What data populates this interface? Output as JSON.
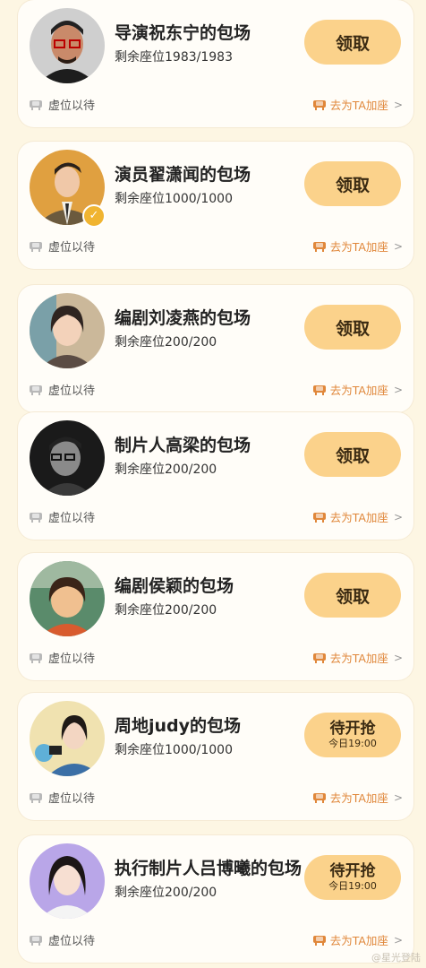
{
  "cards": [
    {
      "title": "导演祝东宁的包场",
      "seats": "剩余座位1983/1983",
      "button": "领取",
      "button_sub": null,
      "avatar": "man-glasses",
      "verified": false,
      "wait_label": "虚位以待",
      "join_label": "去为TA加座"
    },
    {
      "title": "演员翟潇闻的包场",
      "seats": "剩余座位1000/1000",
      "button": "领取",
      "button_sub": null,
      "avatar": "man-suit",
      "verified": true,
      "wait_label": "虚位以待",
      "join_label": "去为TA加座"
    },
    {
      "title": "编剧刘凌燕的包场",
      "seats": "剩余座位200/200",
      "button": "领取",
      "button_sub": null,
      "avatar": "woman-cartoon",
      "verified": false,
      "wait_label": "虚位以待",
      "join_label": "去为TA加座"
    },
    {
      "title": "制片人高梁的包场",
      "seats": "剩余座位200/200",
      "button": "领取",
      "button_sub": null,
      "avatar": "man-bw",
      "verified": false,
      "wait_label": "虚位以待",
      "join_label": "去为TA加座"
    },
    {
      "title": "编剧侯颖的包场",
      "seats": "剩余座位200/200",
      "button": "领取",
      "button_sub": null,
      "avatar": "girl-cartoon",
      "verified": false,
      "wait_label": "虚位以待",
      "join_label": "去为TA加座"
    },
    {
      "title": "周地judy的包场",
      "seats": "剩余座位1000/1000",
      "button": "待开抢",
      "button_sub": "今日19:00",
      "avatar": "woman-camera",
      "verified": false,
      "wait_label": "虚位以待",
      "join_label": "去为TA加座"
    },
    {
      "title": "执行制片人吕博曦的包场",
      "seats": "剩余座位200/200",
      "button": "待开抢",
      "button_sub": "今日19:00",
      "avatar": "woman-portrait",
      "verified": false,
      "wait_label": "虚位以待",
      "join_label": "去为TA加座"
    }
  ],
  "chevron": ">",
  "watermark": "@星光登陆"
}
